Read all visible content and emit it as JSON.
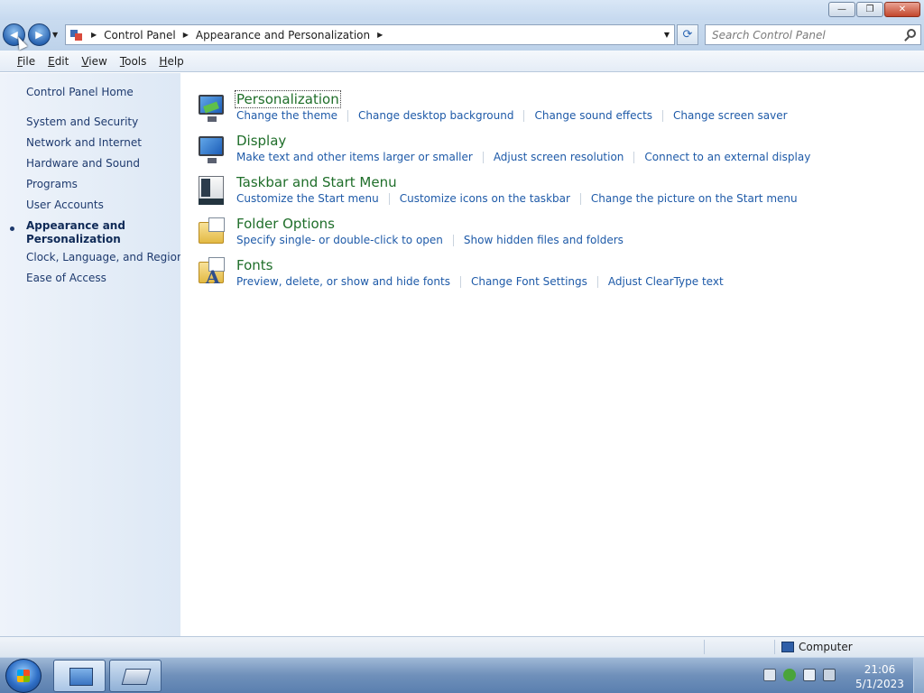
{
  "window": {
    "minimize_glyph": "—",
    "maximize_glyph": "❐",
    "close_glyph": "✕"
  },
  "nav": {
    "back_glyph": "◀",
    "forward_glyph": "▶",
    "refresh_glyph": "⟳"
  },
  "breadcrumb": {
    "items": [
      "Control Panel",
      "Appearance and Personalization"
    ]
  },
  "search": {
    "placeholder": "Search Control Panel"
  },
  "menu": {
    "file": {
      "u": "F",
      "rest": "ile"
    },
    "edit": {
      "u": "E",
      "rest": "dit"
    },
    "view": {
      "u": "V",
      "rest": "iew"
    },
    "tools": {
      "u": "T",
      "rest": "ools"
    },
    "help": {
      "u": "H",
      "rest": "elp"
    }
  },
  "sidebar": {
    "home": "Control Panel Home",
    "items": [
      "System and Security",
      "Network and Internet",
      "Hardware and Sound",
      "Programs",
      "User Accounts",
      "Appearance and Personalization",
      "Clock, Language, and Region",
      "Ease of Access"
    ]
  },
  "sections": [
    {
      "title": "Personalization",
      "icon": "personalization-icon",
      "tasks": [
        "Change the theme",
        "Change desktop background",
        "Change sound effects",
        "Change screen saver"
      ]
    },
    {
      "title": "Display",
      "icon": "display-icon",
      "tasks": [
        "Make text and other items larger or smaller",
        "Adjust screen resolution",
        "Connect to an external display"
      ]
    },
    {
      "title": "Taskbar and Start Menu",
      "icon": "taskbar-icon",
      "tasks": [
        "Customize the Start menu",
        "Customize icons on the taskbar",
        "Change the picture on the Start menu"
      ]
    },
    {
      "title": "Folder Options",
      "icon": "folder-options-icon",
      "tasks": [
        "Specify single- or double-click to open",
        "Show hidden files and folders"
      ]
    },
    {
      "title": "Fonts",
      "icon": "fonts-icon",
      "fonts_glyph": "A",
      "tasks": [
        "Preview, delete, or show and hide fonts",
        "Change Font Settings",
        "Adjust ClearType text"
      ]
    }
  ],
  "status": {
    "location": "Computer"
  },
  "taskbar": {
    "time": "21:06",
    "date": "5/1/2023"
  },
  "colors": {
    "link": "#1e5aa8",
    "section_title": "#1f6e2a",
    "sidebar_bg": "#dde8f5"
  }
}
